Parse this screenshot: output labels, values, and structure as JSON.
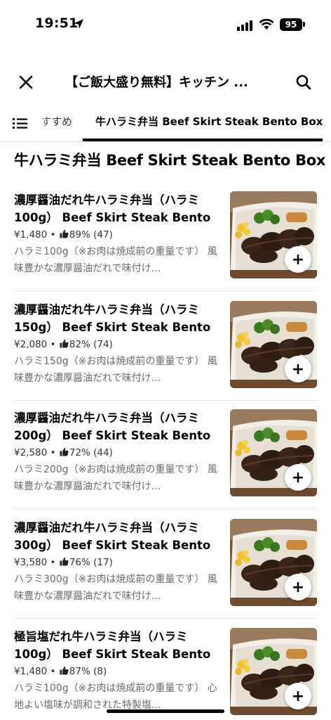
{
  "status_bar": {
    "time": "19:51",
    "battery": "95"
  },
  "header": {
    "title": "【ご飯大盛り無料】キッチン ..."
  },
  "tabs": {
    "previous": "すすめ",
    "active": "牛ハラミ弁当 Beef Skirt Steak Bento Box"
  },
  "section": {
    "title": "牛ハラミ弁当 Beef Skirt Steak Bento Box"
  },
  "items": [
    {
      "name": "濃厚醤油だれ牛ハラミ弁当（ハラミ100g） Beef Skirt Steak Bento ...",
      "price": "¥1,480",
      "rating": "89%",
      "reviews": "(47)",
      "desc": "ハラミ100g（※お肉は焼成前の重量です） 風味豊かな濃厚醤油だれで味付け...",
      "add": "+"
    },
    {
      "name": "濃厚醤油だれ牛ハラミ弁当（ハラミ150g） Beef Skirt Steak Bento ...",
      "price": "¥2,080",
      "rating": "82%",
      "reviews": "(74)",
      "desc": "ハラミ150g（※お肉は焼成前の重量です） 風味豊かな濃厚醤油だれで味付け...",
      "add": "+"
    },
    {
      "name": "濃厚醤油だれ牛ハラミ弁当（ハラミ200g） Beef Skirt Steak Bento ...",
      "price": "¥2,580",
      "rating": "72%",
      "reviews": "(44)",
      "desc": "ハラミ200g（※お肉は焼成前の重量です） 風味豊かな濃厚醤油だれで味付け...",
      "add": "+"
    },
    {
      "name": "濃厚醤油だれ牛ハラミ弁当（ハラミ300g） Beef Skirt Steak Bento ...",
      "price": "¥3,580",
      "rating": "76%",
      "reviews": "(17)",
      "desc": "ハラミ300g（※お肉は焼成前の重量です） 風味豊かな濃厚醤油だれで味付け...",
      "add": "+"
    },
    {
      "name": "極旨塩だれ牛ハラミ弁当（ハラミ100g） Beef Skirt Steak Bento ...",
      "price": "¥1,480",
      "rating": "87%",
      "reviews": "(8)",
      "desc": "ハラミ100g（※お肉は焼成前の重量です） 心地よい塩味が調和された特製塩...",
      "add": "+"
    }
  ]
}
